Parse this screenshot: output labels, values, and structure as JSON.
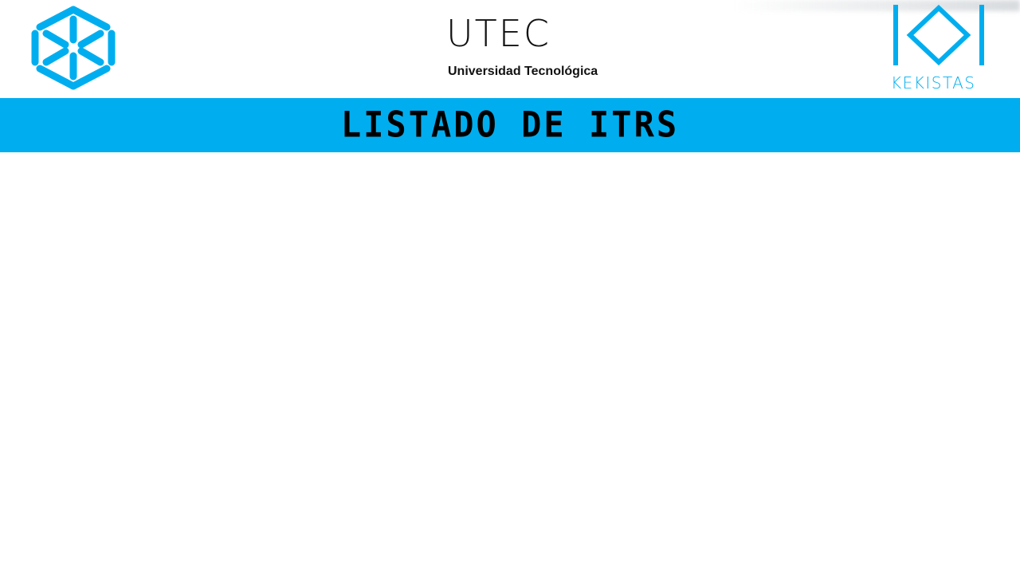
{
  "header": {
    "left_logo": {
      "icon": "hexagon-star-logo-icon",
      "color": "#00aeef"
    },
    "center_logo": {
      "wordmark": "UTEC",
      "subtitle": "Universidad Tecnológica",
      "color": "#111111"
    },
    "right_logo": {
      "icon": "kekistas-logo-icon",
      "label": "KEKISTAS",
      "color": "#00aeef"
    }
  },
  "title_bar": {
    "title": "LISTADO DE ITRS",
    "background": "#00aeef",
    "text_color": "#000000"
  },
  "content": {}
}
